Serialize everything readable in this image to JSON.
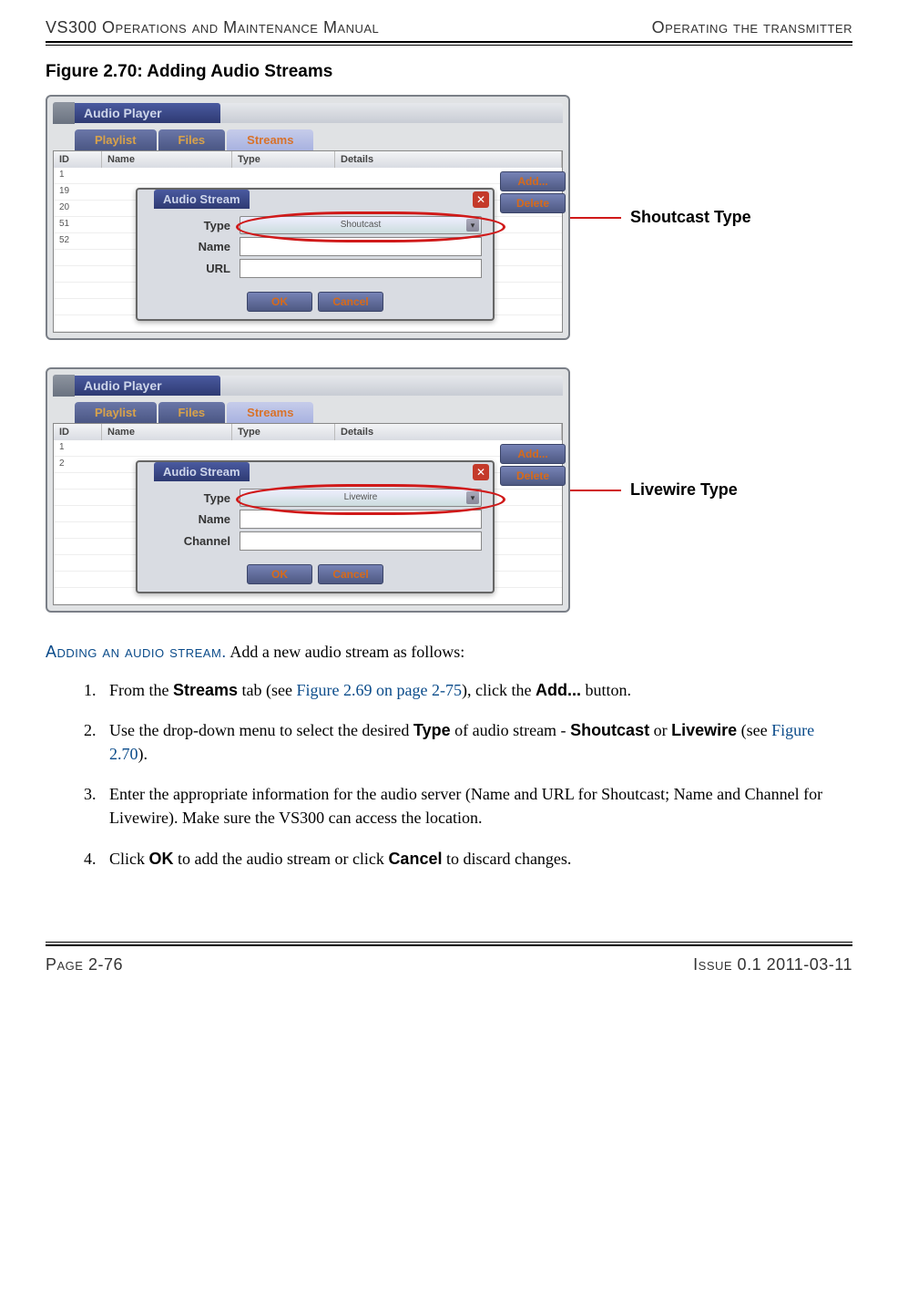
{
  "header": {
    "left": "VS300 Operations and Maintenance Manual",
    "right": "Operating the transmitter"
  },
  "figure_title": "Figure 2.70: Adding Audio Streams",
  "shot1": {
    "app_title": "Audio Player",
    "tabs": {
      "t1": "Playlist",
      "t2": "Files",
      "t3": "Streams"
    },
    "cols": {
      "id": "ID",
      "name": "Name",
      "type": "Type",
      "details": "Details"
    },
    "rows": [
      "1",
      "19",
      "20",
      "51",
      "52"
    ],
    "side": {
      "add": "Add...",
      "del": "Delete"
    },
    "dialog": {
      "title": "Audio Stream",
      "labels": {
        "type": "Type",
        "name": "Name",
        "url": "URL"
      },
      "type_value": "Shoutcast",
      "ok": "OK",
      "cancel": "Cancel"
    },
    "annotation": "Shoutcast Type"
  },
  "shot2": {
    "app_title": "Audio Player",
    "tabs": {
      "t1": "Playlist",
      "t2": "Files",
      "t3": "Streams"
    },
    "cols": {
      "id": "ID",
      "name": "Name",
      "type": "Type",
      "details": "Details"
    },
    "rows": [
      "1",
      "2"
    ],
    "side": {
      "add": "Add...",
      "del": "Delete"
    },
    "dialog": {
      "title": "Audio Stream",
      "labels": {
        "type": "Type",
        "name": "Name",
        "channel": "Channel"
      },
      "type_value": "Livewire",
      "ok": "OK",
      "cancel": "Cancel"
    },
    "annotation": "Livewire Type"
  },
  "body": {
    "runin": "Adding an audio stream.",
    "rest": " Add a new audio stream as follows:",
    "steps": {
      "s1a": "From the ",
      "s1b": "Streams",
      "s1c": " tab (see ",
      "s1link": "Figure 2.69 on page 2-75",
      "s1d": "), click the ",
      "s1e": "Add...",
      "s1f": " button.",
      "s2a": "Use the drop-down menu to select the desired ",
      "s2b": "Type",
      "s2c": " of audio stream - ",
      "s2d": "Shoutcast",
      "s2e": " or ",
      "s2f": "Livewire",
      "s2g": " (see ",
      "s2link": "Figure 2.70",
      "s2h": ").",
      "s3": "Enter the appropriate information for the audio server (Name and URL for Shoutcast; Name and Channel for Livewire). Make sure the VS300 can access the location.",
      "s4a": "Click ",
      "s4b": "OK",
      "s4c": " to add the audio stream or click ",
      "s4d": "Cancel",
      "s4e": " to discard changes."
    }
  },
  "footer": {
    "left": "Page 2-76",
    "right": "Issue 0.1  2011-03-11"
  }
}
